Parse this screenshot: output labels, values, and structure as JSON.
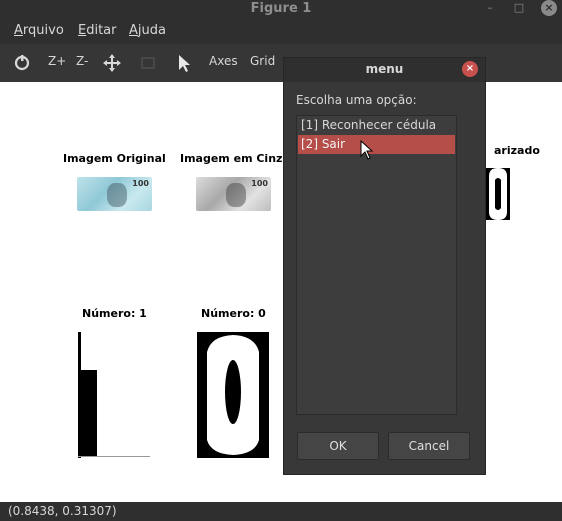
{
  "window": {
    "title": "Figure 1"
  },
  "menubar": [
    {
      "label": "Arquivo",
      "accel": "A",
      "rest": "rquivo"
    },
    {
      "label": "Editar",
      "accel": "E",
      "rest": "ditar"
    },
    {
      "label": "Ajuda",
      "accel": "A",
      "rest": "juda"
    }
  ],
  "toolbar": {
    "zoom_in": "Z+",
    "zoom_out": "Z-",
    "axes": "Axes",
    "grid": "Grid",
    "icons": [
      "refresh-icon",
      "pan-move-icon",
      "cursor-icon"
    ]
  },
  "figure": {
    "titles": {
      "original": "Imagem Original",
      "gray": "Imagem em Cinza",
      "binarized_partial": "arizado",
      "number1": "Número: 1",
      "number0": "Número: 0"
    },
    "note_label": "100"
  },
  "dialog": {
    "title": "menu",
    "prompt": "Escolha uma opção:",
    "options": [
      "[1] Reconhecer cédula",
      "[2] Sair"
    ],
    "selected_index": 1,
    "ok_label": "OK",
    "cancel_label": "Cancel"
  },
  "status": {
    "coords": "(0.8438, 0.31307)"
  }
}
